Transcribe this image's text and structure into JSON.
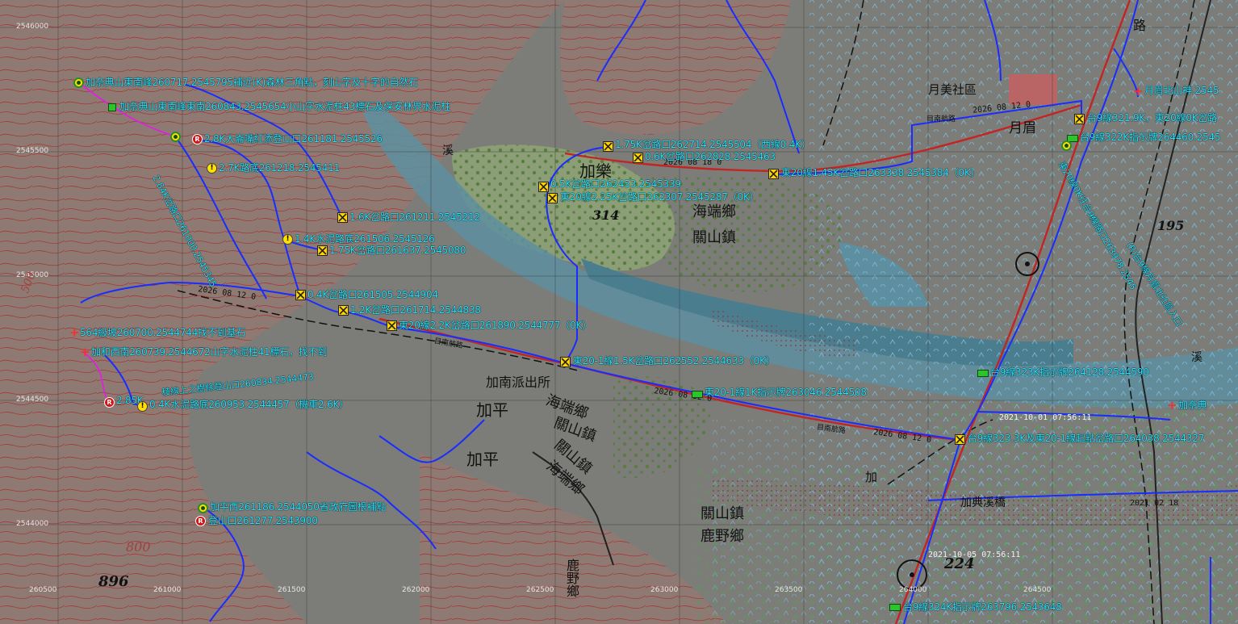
{
  "map": {
    "grid_labels": {
      "northing": [
        "2546000",
        "2545500",
        "2545000",
        "2544500",
        "2544000"
      ],
      "easting": [
        "260500",
        "261000",
        "261500",
        "262000",
        "262500",
        "263000",
        "263500",
        "264000",
        "264500"
      ]
    },
    "places": {
      "yuemei": "月美社區",
      "jiale": "加樂",
      "jiaping": "加平",
      "jiaping2": "加平",
      "hai_duan": "海端鄉",
      "guan_shan": "關山鎮",
      "hai_duan2": "海端鄉",
      "guan_shan2": "關山鎮",
      "guan_shan3": "關山鎮",
      "hai_duan3": "海端鄉",
      "guan_shan4": "關山鎮",
      "luye": "鹿野鄉",
      "luye2": "鹿野鄉",
      "jiadian_bridge": "加典溪橋",
      "police": "加南派出所",
      "xi1": "溪",
      "xi2": "溪",
      "yuemei_short": "月眉",
      "road": "路",
      "jia": "加"
    },
    "elevations": {
      "e314": "314",
      "e896": "896",
      "e224": "224",
      "e800": "800",
      "e195": "195",
      "e500": "500"
    },
    "timestamps": {
      "t1": "2021-10-01 07:56:11",
      "t2": "2021-10-05 07:56:11"
    },
    "road_marks": {
      "m1": "2026 08 12 0",
      "m2": "2026 08 12 0",
      "m3": "2026 08 12 0",
      "m4": "2026 08 12 0",
      "m5": "2026 08 18 0",
      "m6": "2021 02 18",
      "m7": "目南航路",
      "m8": "目南航路",
      "m9": "目南航路"
    },
    "waypoints": [
      {
        "id": "w1",
        "icon": "target",
        "text": "加奈典山東南峰260717.2545795補近(K)森林三角點，刻山字及十字的自然石"
      },
      {
        "id": "w2",
        "icon": "green-square",
        "text": "加奈典山東南峰東南260843.2545654小山字水泥柱43標石及保安林界水泥柱"
      },
      {
        "id": "w3",
        "icon": "target",
        "text": ""
      },
      {
        "id": "w4",
        "icon": "R",
        "text": "2.8K大崙嘴紅添登山口261181.2545526"
      },
      {
        "id": "w5",
        "icon": "warn",
        "text": "2.7K路底261218.2545411"
      },
      {
        "id": "w6",
        "icon": "x",
        "text": "1.6K岔路口261211.2545212"
      },
      {
        "id": "w7",
        "icon": "warn",
        "text": "1.4K水泥路底261506.2545126"
      },
      {
        "id": "w8",
        "icon": "x",
        "text": "1.75K岔路口261637.2545080"
      },
      {
        "id": "w9",
        "icon": "x",
        "text": "0.4K岔路口261505.2544904"
      },
      {
        "id": "w10",
        "icon": "x",
        "text": "1.2K岔路口261714.2544838"
      },
      {
        "id": "w11",
        "icon": "x",
        "text": "東20線2.2K岔路口261890.2544777（0K）"
      },
      {
        "id": "w12",
        "icon": "plus",
        "text": "564級坡260700.2544744找不到基石"
      },
      {
        "id": "w13",
        "icon": "plus",
        "text": "加和西南260739.2544672山字水泥柱41標石，找不到"
      },
      {
        "id": "w14",
        "icon": "x",
        "text": "東20-1線1.5K岔路口262552.2544633（0K）"
      },
      {
        "id": "w15",
        "icon": "R",
        "text": "2.85K"
      },
      {
        "id": "w16",
        "icon": "warn",
        "text": "0.4K水泥路底260953.2544457（機車2.6K）"
      },
      {
        "id": "w17",
        "icon": "text",
        "text": "稜線上之樹條登山口260834.2544473"
      },
      {
        "id": "w18",
        "icon": "sign",
        "text": "東20-1線1K指示牌263046.2544508"
      },
      {
        "id": "w19",
        "icon": "x",
        "text": "台9線323.3K及東20-1線起點岔路口264038.2544327"
      },
      {
        "id": "w20",
        "icon": "sign",
        "text": "台9線323K指示牌264128.2544590"
      },
      {
        "id": "w21",
        "icon": "target",
        "text": "加平西261186.2544050省政府圖根補點"
      },
      {
        "id": "w22",
        "icon": "R",
        "text": "登山口261277.2543900"
      },
      {
        "id": "w23",
        "icon": "sign",
        "text": "台9線324K指示牌263796.2543648"
      },
      {
        "id": "w24",
        "icon": "x",
        "text": "1.75K岔路口262714.2545504（西線0.4K）"
      },
      {
        "id": "w25",
        "icon": "x",
        "text": "0.6K岔路口262828.2545463"
      },
      {
        "id": "w26",
        "icon": "x",
        "text": "0.5K岔路口262453.2545339"
      },
      {
        "id": "w27",
        "icon": "x",
        "text": "東20線2.25K岔路口262307.2545287（0K）"
      },
      {
        "id": "w28",
        "icon": "x",
        "text": "東20線1.45K岔路口263338.2545384（0K）"
      },
      {
        "id": "w29",
        "icon": "x",
        "text": "台9線321.9K，東20線0K岔路"
      },
      {
        "id": "w30",
        "icon": "sign",
        "text": "台9線322K指示牌264460.2545"
      },
      {
        "id": "w31",
        "icon": "target",
        "text": ""
      },
      {
        "id": "w32",
        "icon": "plus",
        "text": "月眉北山神.2545"
      },
      {
        "id": "w33",
        "icon": "plus",
        "text": "加奈典"
      },
      {
        "id": "w34",
        "icon": "text",
        "text": "2.84K岔路口261000.2545345"
      },
      {
        "id": "w35",
        "icon": "text",
        "text": "東20線0K往台9線路口263978.2545"
      },
      {
        "id": "w36",
        "icon": "text",
        "text": "(R)台9線月眉北社區入口"
      }
    ],
    "colors": {
      "label": "#27e3ff",
      "route": "#1a2cff",
      "track": "#e020e0",
      "river": "#5e8fa0",
      "contour": "#a24040",
      "marker_x": "#ffd500",
      "marker_r": "#d01717"
    }
  }
}
